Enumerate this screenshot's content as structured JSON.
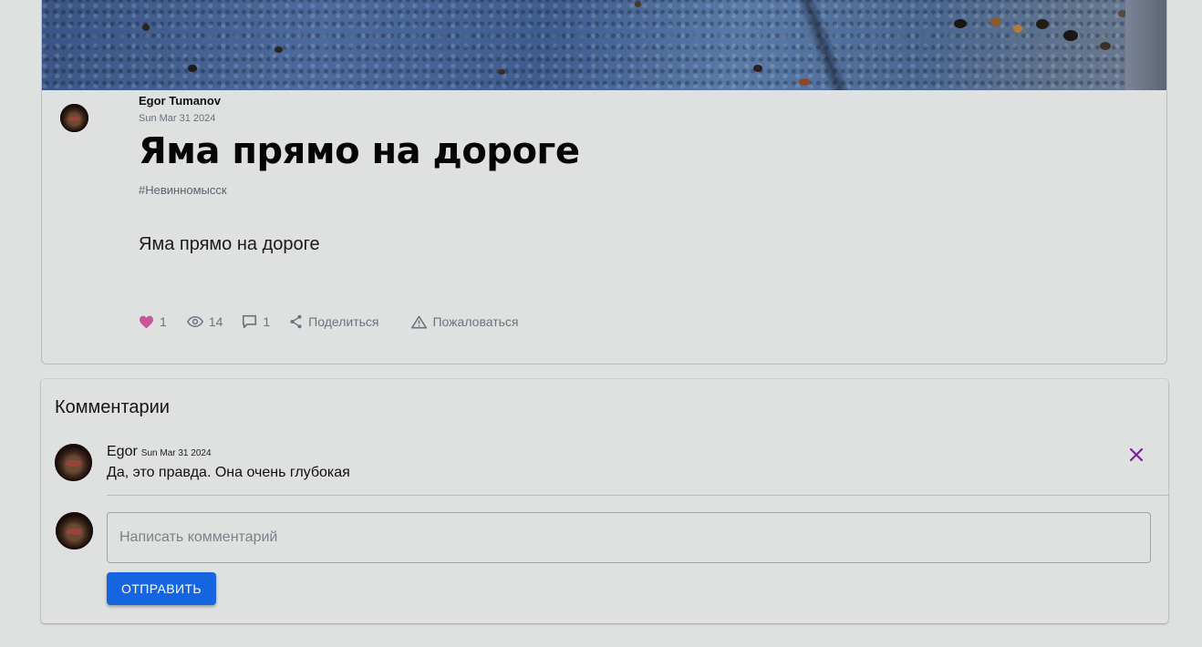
{
  "post": {
    "author": "Egor Tumanov",
    "date": "Sun Mar 31 2024",
    "title": "Яма прямо на дороге",
    "tag": "#Невинномысск",
    "body": "Яма прямо на дороге",
    "likes": "1",
    "views": "14",
    "comments_count": "1",
    "share_label": "Поделиться",
    "report_label": "Пожаловаться",
    "like_color": "#c9569a"
  },
  "comments": {
    "title": "Комментарии",
    "items": [
      {
        "author": "Egor",
        "date": "Sun Mar 31 2024",
        "text": "Да, это правда. Она очень глубокая"
      }
    ],
    "input_placeholder": "Написать комментарий",
    "send_label": "ОТПРАВИТЬ",
    "send_color": "#1565e0",
    "delete_color": "#7b1fa2"
  }
}
